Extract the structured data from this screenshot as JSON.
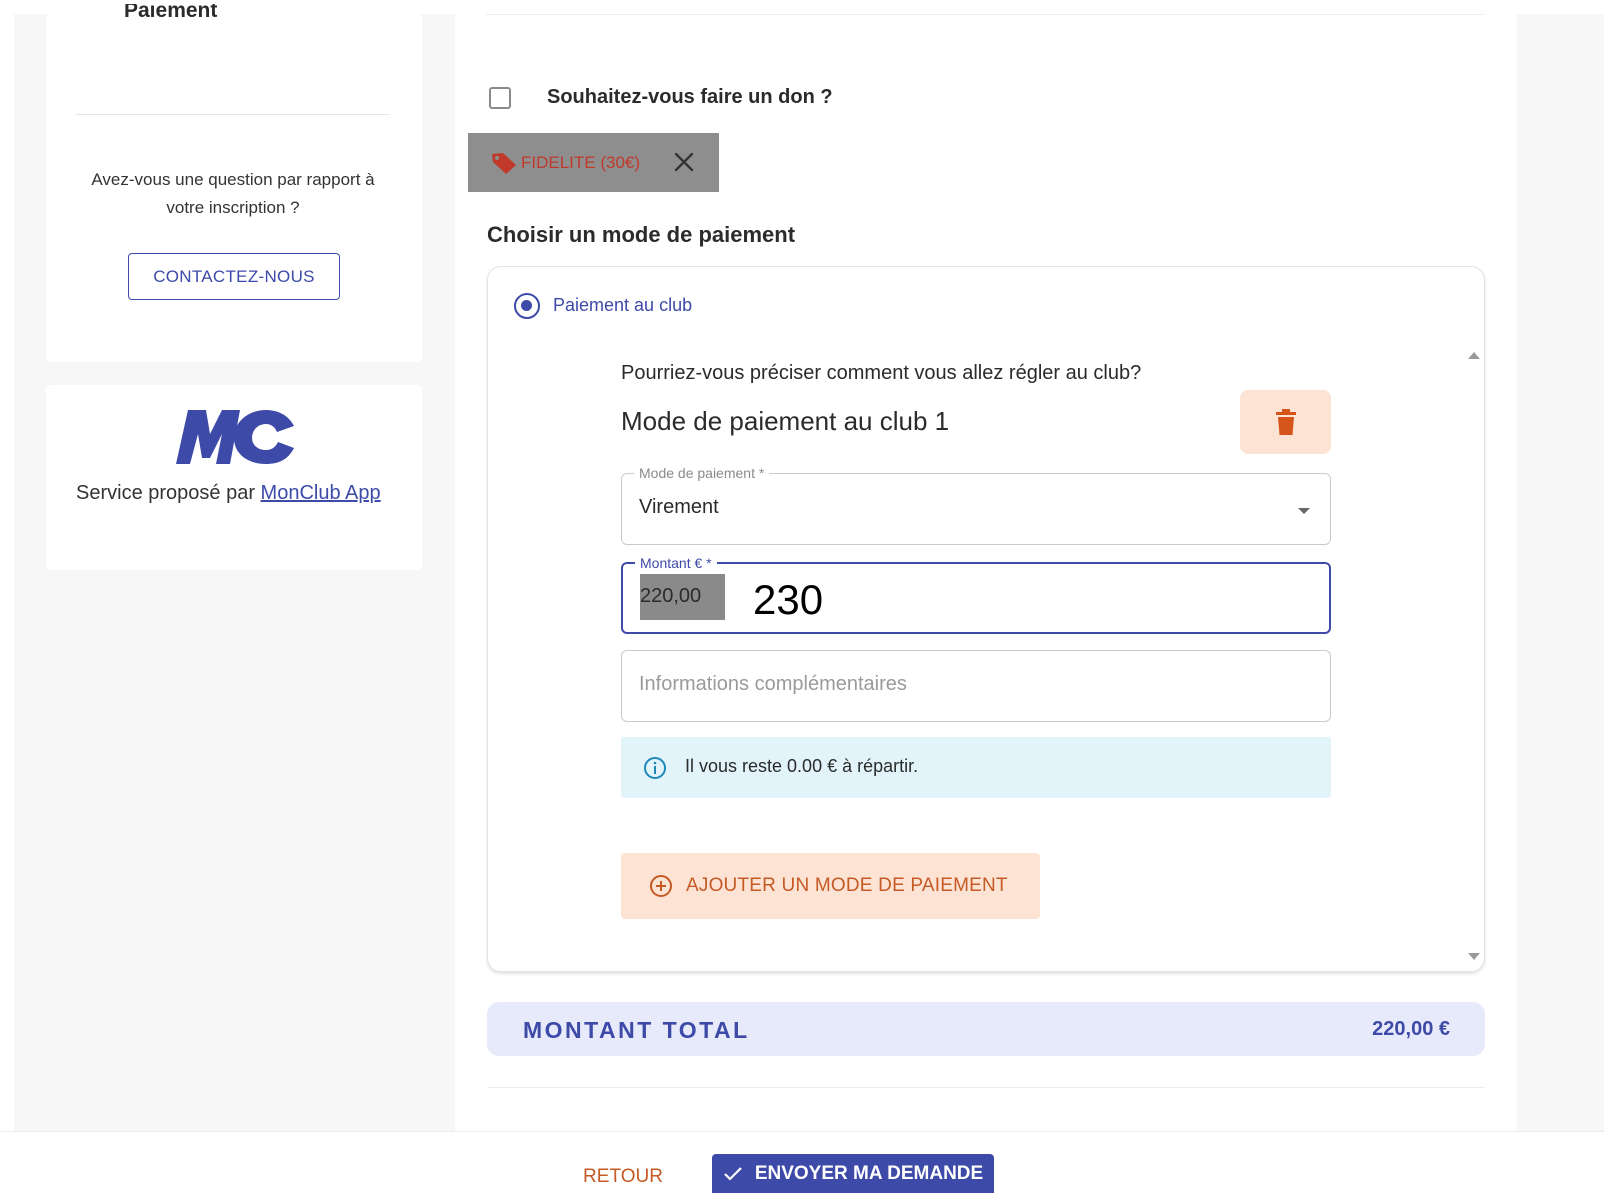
{
  "sidebar": {
    "section_title": "Paiement",
    "question": "Avez-vous une question par rapport à votre inscription ?",
    "contact_button": "CONTACTEZ-NOUS",
    "service_text": "Service proposé par ",
    "service_link": "MonClub App",
    "logo_text": "MC"
  },
  "donation": {
    "label": "Souhaitez-vous faire un don ?",
    "checked": false
  },
  "discount_chip": {
    "label": "FIDELITE (30€)",
    "icon": "tag-icon",
    "close_icon": "close-icon"
  },
  "payment": {
    "section_title": "Choisir un mode de paiement",
    "option_label": "Paiement au club",
    "question": "Pourriez-vous préciser comment vous allez régler au club?",
    "mode_title": "Mode de paiement au club 1",
    "mode_field": {
      "legend": "Mode de paiement *",
      "value": "Virement"
    },
    "amount_field": {
      "legend": "Montant € *",
      "value": "220,00",
      "annotation": "230"
    },
    "info_field": {
      "placeholder": "Informations complémentaires"
    },
    "alert_text": "Il vous reste 0.00 € à répartir.",
    "add_button": "AJOUTER UN MODE DE PAIEMENT"
  },
  "total": {
    "label": "MONTANT TOTAL",
    "value": "220,00 €"
  },
  "footer": {
    "back_button": "RETOUR",
    "send_button": "ENVOYER MA DEMANDE"
  },
  "colors": {
    "primary": "#3d4aa8",
    "accent_orange": "#c65a25",
    "accent_orange_bg": "#fde3d4",
    "info_bg": "#e2f4fa",
    "total_bg": "#e7eafb"
  }
}
